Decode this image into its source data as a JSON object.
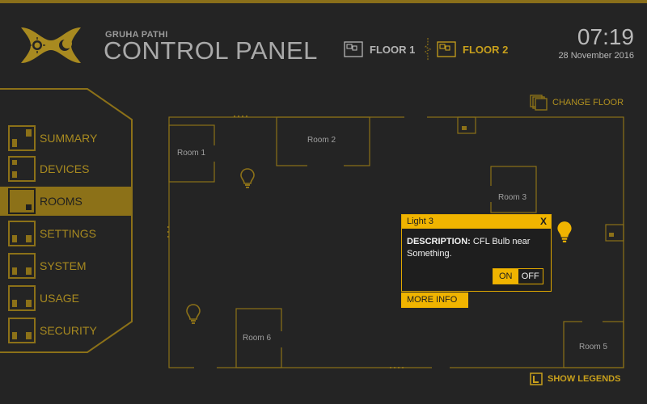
{
  "header": {
    "brand_sub": "GRUHA PATHI",
    "brand_title": "CONTROL PANEL",
    "floors": [
      {
        "label": "FLOOR 1",
        "active": false
      },
      {
        "label": "FLOOR 2",
        "active": true
      }
    ],
    "time": "07:19",
    "date": "28 November 2016"
  },
  "sidebar": {
    "items": [
      {
        "label": "SUMMARY",
        "active": false
      },
      {
        "label": "DEVICES",
        "active": false
      },
      {
        "label": "ROOMS",
        "active": true
      },
      {
        "label": "SETTINGS",
        "active": false
      },
      {
        "label": "SYSTEM",
        "active": false
      },
      {
        "label": "USAGE",
        "active": false
      },
      {
        "label": "SECURITY",
        "active": false
      }
    ]
  },
  "floorplan": {
    "change_floor_label": "CHANGE FLOOR",
    "show_legends_label": "SHOW LEGENDS",
    "rooms": [
      "Room 1",
      "Room 2",
      "Room 3",
      "Room 5",
      "Room 6"
    ]
  },
  "popup": {
    "title": "Light 3",
    "close": "X",
    "desc_label": "DESCRIPTION:",
    "desc_text": "CFL Bulb near Something.",
    "on": "ON",
    "off": "OFF",
    "state": "on",
    "more_info": "MORE INFO"
  },
  "colors": {
    "accent": "#c8a01c",
    "accent_dark": "#8c7118",
    "popup_accent": "#f0b400",
    "background": "#242424"
  }
}
